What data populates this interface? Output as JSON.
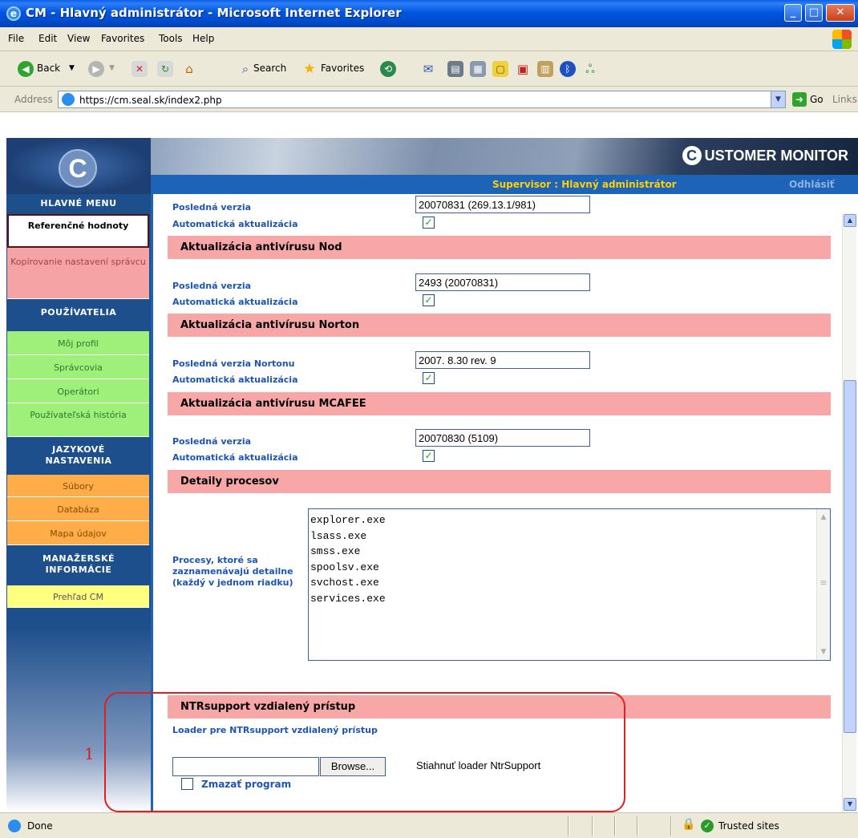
{
  "window": {
    "title": "CM - Hlavný administrátor - Microsoft Internet Explorer"
  },
  "menu": [
    "File",
    "Edit",
    "View",
    "Favorites",
    "Tools",
    "Help"
  ],
  "toolbar": {
    "back": "Back",
    "search": "Search",
    "favorites": "Favorites"
  },
  "address": {
    "label": "Address",
    "url": "https://cm.seal.sk/index2.php",
    "go": "Go",
    "links": "Links"
  },
  "header": {
    "logo_letter": "C",
    "brand": "USTOMER MONITOR",
    "brand_letter": "C",
    "supervisor": "Supervisor : Hlavný administrátor",
    "logout": "Odhlásiť"
  },
  "sidebar": {
    "main_menu": "HLAVNÉ MENU",
    "reference": "Referenčné hodnoty",
    "copy_settings": "Kopírovanie nastavení správcu",
    "users": "POUŽÍVATELIA",
    "my_profile": "Môj profil",
    "admins": "Správcovia",
    "operators": "Operátori",
    "user_history": "Používateľská história",
    "lang_head": "JAZYKOVÉ NASTAVENIA",
    "files": "Súbory",
    "database": "Databáza",
    "data_map": "Mapa údajov",
    "mgmt_head": "MANAŽERSKÉ INFORMÁCIE",
    "cm_overview": "Prehľad CM"
  },
  "content": {
    "top": {
      "label": "Posledná verzia",
      "value": "20070831 (269.13.1/981)",
      "auto_label": "Automatická aktualizácia"
    },
    "nod": {
      "title": "Aktualizácia antivírusu Nod",
      "label": "Posledná verzia",
      "value": "2493 (20070831)",
      "auto_label": "Automatická aktualizácia"
    },
    "norton": {
      "title": "Aktualizácia antivírusu Norton",
      "label": "Posledná verzia Nortonu",
      "value": "2007. 8.30 rev. 9",
      "auto_label": "Automatická aktualizácia"
    },
    "mcafee": {
      "title": "Aktualizácia antivírusu MCAFEE",
      "label": "Posledná verzia",
      "value": "20070830 (5109)",
      "auto_label": "Automatická aktualizácia"
    },
    "processes": {
      "title": "Detaily procesov",
      "label": "Procesy, ktoré sa zaznamenávajú detailne (každý v jednom riadku)",
      "list": "explorer.exe\nlsass.exe\nsmss.exe\nspoolsv.exe\nsvchost.exe\nservices.exe"
    },
    "ntr": {
      "title": "NTRsupport vzdialený prístup",
      "loader_label": "Loader pre NTRsupport vzdialený prístup",
      "browse": "Browse...",
      "download": "Stiahnuť loader NtrSupport",
      "delete_label": "Zmazať program"
    }
  },
  "annotation": {
    "number": "1"
  },
  "status": {
    "text": "Done",
    "zone": "Trusted sites"
  }
}
